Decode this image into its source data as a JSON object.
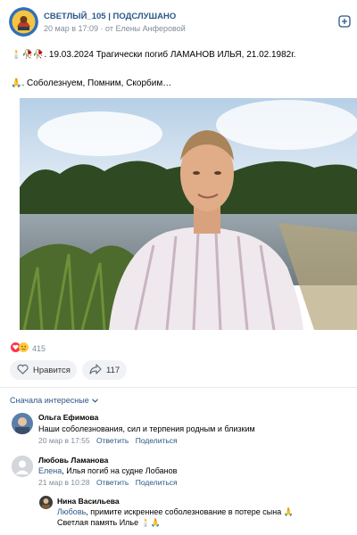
{
  "post": {
    "group_name": "СВЕТЛЫЙ_105 | ПОДСЛУШАНО",
    "meta": "20 мар в 17:09 · от Елены Анферовой",
    "text_line1": "🕯️🥀🥀. 19.03.2024 Трагически погиб ЛАМАНОВ ИЛЬЯ, 21.02.1982г.",
    "text_line2": "🙏. Соболезнуем, Помним, Скорбим…",
    "reactions_count": "415",
    "like_label": "Нравится",
    "share_count": "117"
  },
  "comments": {
    "sort_label": "Сначала интересные",
    "items": [
      {
        "author": "Ольга Ефимова",
        "text": "Наши соболезнования, сил и терпения родным и близким",
        "time": "20 мар в 17:55",
        "reply": "Ответить",
        "share": "Поделиться"
      },
      {
        "author": "Любовь Ламанова",
        "mention": "Елена",
        "text": ", Илья погиб на судне Лобанов",
        "time": "21 мар в 10:28",
        "reply": "Ответить",
        "share": "Поделиться"
      },
      {
        "author": "Нина Васильева",
        "mention": "Любовь",
        "text": ", примите искреннее соболезнование в потере сына 🙏",
        "text2": "Светлая память Илье 🕯️🙏"
      }
    ]
  },
  "colors": {
    "link": "#2a5885",
    "meta": "#818c99",
    "button_bg": "#f0f2f5",
    "divider": "#e7e8ec"
  },
  "icons": [
    "group-avatar",
    "add-icon",
    "heart-reaction-icon",
    "sad-reaction-icon",
    "heart-outline-icon",
    "share-arrow-icon",
    "chevron-down-icon"
  ]
}
